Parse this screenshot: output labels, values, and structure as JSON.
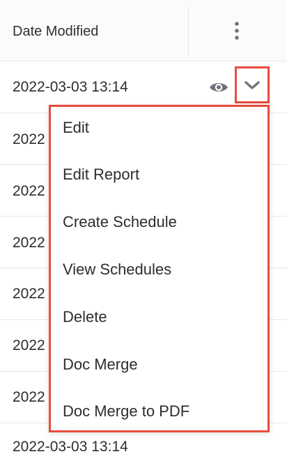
{
  "table": {
    "column_header": "Date Modified",
    "rows": [
      "2022-03-03 13:14",
      "2022",
      "2022",
      "2022",
      "2022",
      "2022",
      "2022",
      "2022-03-03 13:14"
    ]
  },
  "menu": {
    "items": [
      "Edit",
      "Edit Report",
      "Create Schedule",
      "View Schedules",
      "Delete",
      "Doc Merge",
      "Doc Merge to PDF"
    ]
  },
  "icons": {
    "kebab": "kebab-menu-icon",
    "eye": "eye-icon",
    "chevron": "chevron-down-icon"
  },
  "colors": {
    "highlight": "#e74c3c",
    "icon": "#6f737a",
    "divider": "#e5e7ea"
  }
}
